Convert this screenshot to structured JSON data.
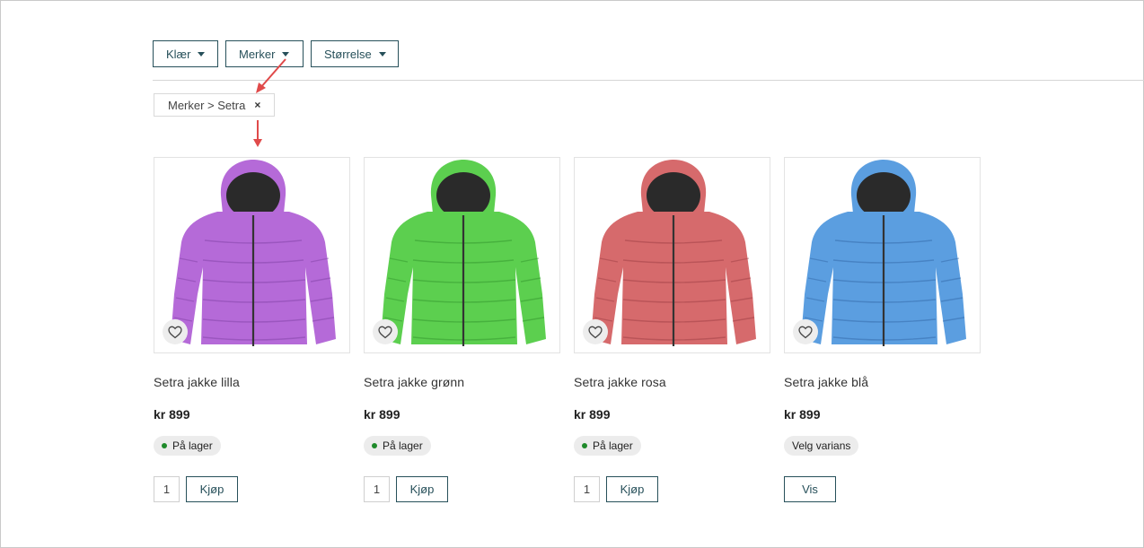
{
  "filters": [
    {
      "label": "Klær"
    },
    {
      "label": "Merker"
    },
    {
      "label": "Størrelse"
    }
  ],
  "active_filter": {
    "label": "Merker > Setra",
    "remove_symbol": "×"
  },
  "products": [
    {
      "title": "Setra jakke lilla",
      "price": "kr 899",
      "status": "På lager",
      "in_stock": true,
      "qty": "1",
      "action": "Kjøp",
      "color": "#b56ad8",
      "dark": "#7d3ea2"
    },
    {
      "title": "Setra jakke grønn",
      "price": "kr 899",
      "status": "På lager",
      "in_stock": true,
      "qty": "1",
      "action": "Kjøp",
      "color": "#5ccf4f",
      "dark": "#2f8f2a"
    },
    {
      "title": "Setra jakke rosa",
      "price": "kr 899",
      "status": "På lager",
      "in_stock": true,
      "qty": "1",
      "action": "Kjøp",
      "color": "#d66a6c",
      "dark": "#9a3b40"
    },
    {
      "title": "Setra jakke blå",
      "price": "kr 899",
      "status": "Velg varians",
      "in_stock": false,
      "qty": "",
      "action": "Vis",
      "color": "#5b9ee0",
      "dark": "#2f64a3"
    }
  ],
  "colors": {
    "accent": "#27505a",
    "stock_dot": "#1e8a2a",
    "annotation_arrow": "#e04a4a"
  },
  "icons": {
    "caret": "caret-down-icon",
    "favorite": "heart-icon",
    "remove": "close-icon"
  }
}
